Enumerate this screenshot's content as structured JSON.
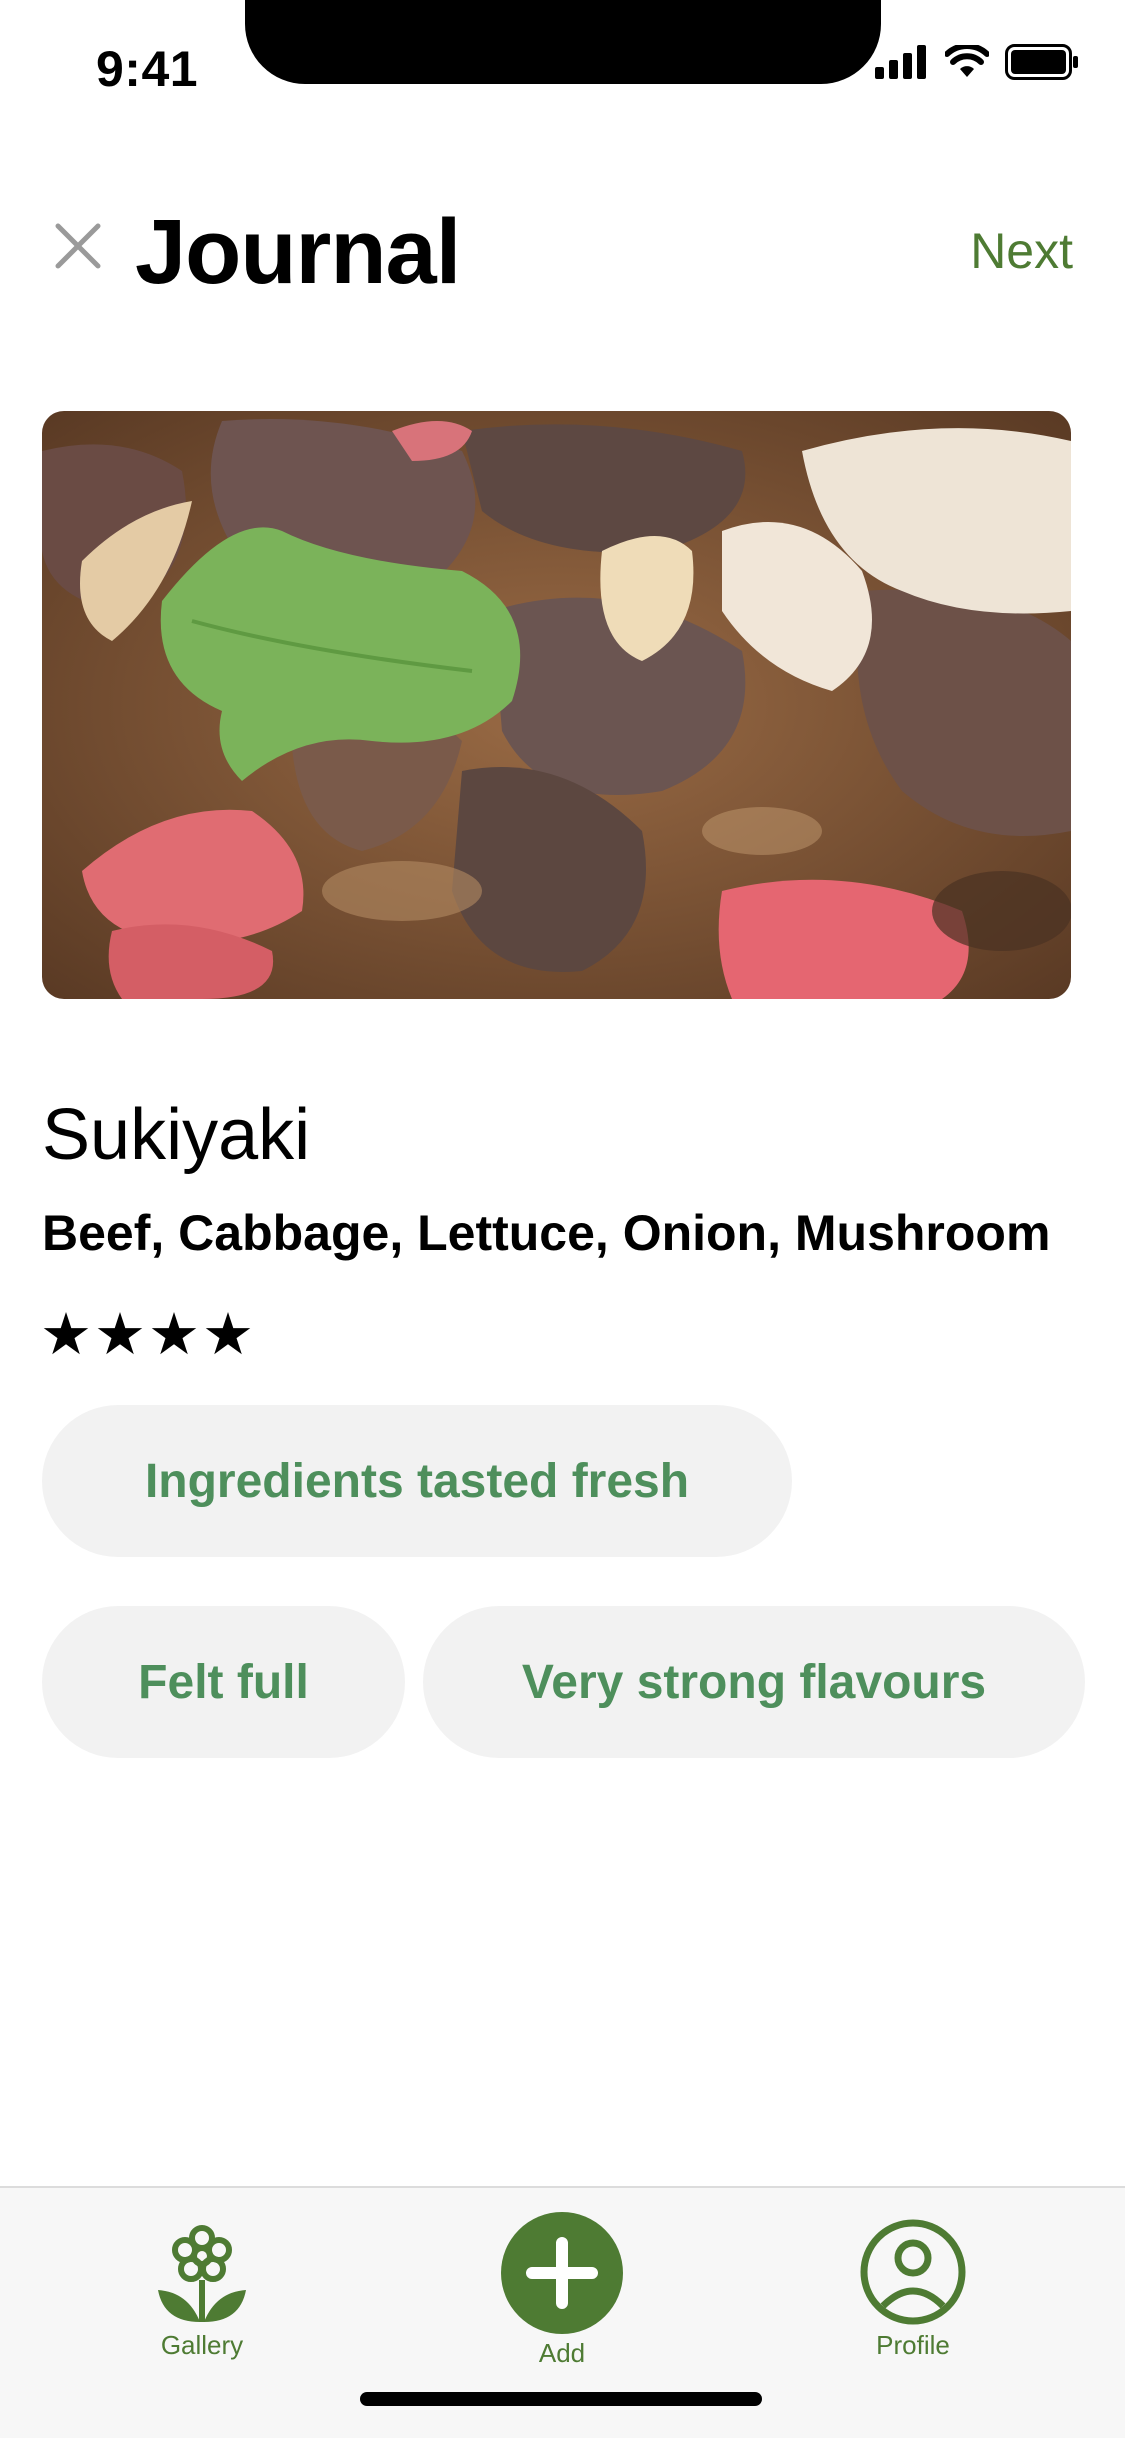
{
  "status_bar": {
    "time": "9:41",
    "icons": [
      "signal-icon",
      "wifi-icon",
      "battery-icon"
    ]
  },
  "header": {
    "close_icon": "close-icon",
    "title": "Journal",
    "next_label": "Next"
  },
  "dish": {
    "photo": "sukiyaki-photo",
    "title": "Sukiyaki",
    "ingredients": "Beef, Cabbage, Lettuce, Onion, Mushroom",
    "rating_text": "★★★★",
    "rating": 4
  },
  "tags": [
    "Ingredients tasted fresh",
    "Felt full",
    "Very strong flavours"
  ],
  "tab_bar": {
    "items": [
      {
        "label": "Gallery",
        "icon": "flower-icon"
      },
      {
        "label": "Add",
        "icon": "plus-circle-icon"
      },
      {
        "label": "Profile",
        "icon": "user-circle-icon"
      }
    ]
  },
  "colors": {
    "accent": "#4e7b33",
    "tag_text": "#4e8f5c",
    "tag_bg": "#f2f2f2"
  }
}
